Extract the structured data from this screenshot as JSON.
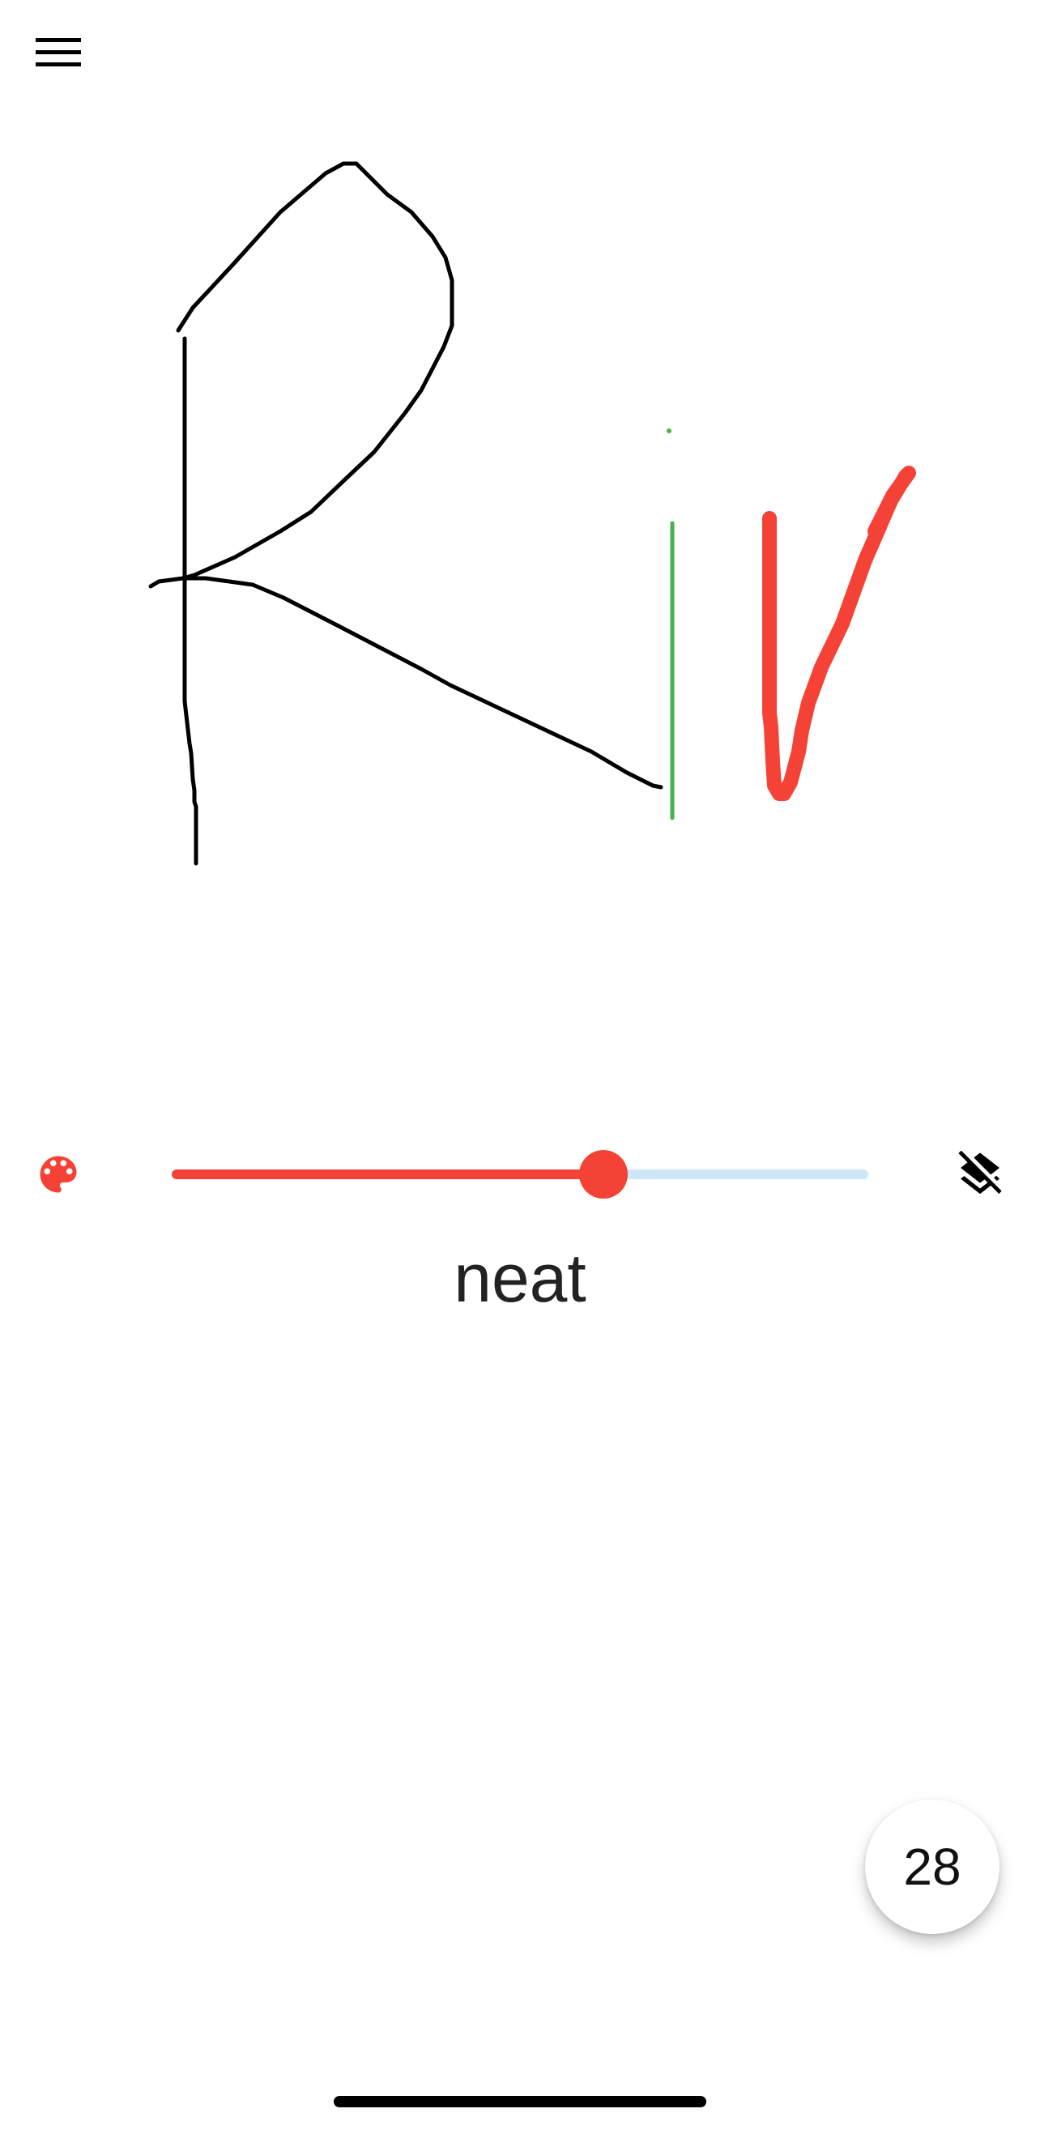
{
  "icons": {
    "menu": "menu-icon",
    "palette": "palette-icon",
    "layers": "layers-clear-icon"
  },
  "colors": {
    "accent": "#f44336",
    "track": "#cde6f9",
    "ink_black": "#000000",
    "ink_green": "#4caf50",
    "ink_red": "#f44336"
  },
  "slider": {
    "value": 0.62
  },
  "caption": "neat",
  "fab": {
    "label": "28"
  }
}
